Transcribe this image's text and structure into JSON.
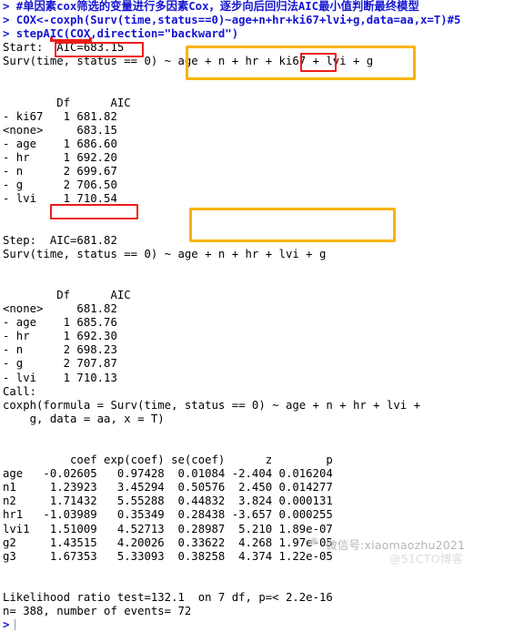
{
  "console": {
    "lines": [
      {
        "id": "l1",
        "type": "command",
        "text": "> #单因素cox筛选的变量进行多因素Cox，逐步向后回归法AIC最小值判断最终模型"
      },
      {
        "id": "l2",
        "type": "command",
        "text": "> COX<-coxph(Surv(time,status==0)~age+n+hr+ki67+lvi+g,data=aa,x=T)#5"
      },
      {
        "id": "l3",
        "type": "command",
        "text": "> stepAIC(COX,direction=\"backward\")"
      },
      {
        "id": "l4",
        "type": "output",
        "text": "Start:  AIC=683.15"
      },
      {
        "id": "l5",
        "type": "output",
        "text": "Surv(time, status == 0) ~ age + n + hr + ki67 + lvi + g"
      },
      {
        "id": "l6",
        "type": "blank",
        "text": ""
      },
      {
        "id": "l7",
        "type": "blank",
        "text": ""
      },
      {
        "id": "l8",
        "type": "output",
        "text": "        Df      AIC"
      },
      {
        "id": "l9",
        "type": "output",
        "text": "- ki67   1 681.82"
      },
      {
        "id": "l10",
        "type": "output",
        "text": "<none>     683.15"
      },
      {
        "id": "l11",
        "type": "output",
        "text": "- age    1 686.60"
      },
      {
        "id": "l12",
        "type": "output",
        "text": "- hr     1 692.20"
      },
      {
        "id": "l13",
        "type": "output",
        "text": "- n      2 699.67"
      },
      {
        "id": "l14",
        "type": "output",
        "text": "- g      2 706.50"
      },
      {
        "id": "l15",
        "type": "output",
        "text": "- lvi    1 710.54"
      },
      {
        "id": "l16",
        "type": "blank",
        "text": ""
      },
      {
        "id": "l17",
        "type": "blank",
        "text": ""
      },
      {
        "id": "l18",
        "type": "output",
        "text": "Step:  AIC=681.82"
      },
      {
        "id": "l19",
        "type": "output",
        "text": "Surv(time, status == 0) ~ age + n + hr + lvi + g"
      },
      {
        "id": "l20",
        "type": "blank",
        "text": ""
      },
      {
        "id": "l21",
        "type": "blank",
        "text": ""
      },
      {
        "id": "l22",
        "type": "output",
        "text": "        Df      AIC"
      },
      {
        "id": "l23",
        "type": "output",
        "text": "<none>     681.82"
      },
      {
        "id": "l24",
        "type": "output",
        "text": "- age    1 685.76"
      },
      {
        "id": "l25",
        "type": "output",
        "text": "- hr     1 692.30"
      },
      {
        "id": "l26",
        "type": "output",
        "text": "- n      2 698.23"
      },
      {
        "id": "l27",
        "type": "output",
        "text": "- g      2 707.87"
      },
      {
        "id": "l28",
        "type": "output",
        "text": "- lvi    1 710.13"
      },
      {
        "id": "l29",
        "type": "output",
        "text": "Call:"
      },
      {
        "id": "l30",
        "type": "output",
        "text": "coxph(formula = Surv(time, status == 0) ~ age + n + hr + lvi +"
      },
      {
        "id": "l31",
        "type": "output",
        "text": "    g, data = aa, x = T)"
      },
      {
        "id": "l32",
        "type": "blank",
        "text": ""
      },
      {
        "id": "l33",
        "type": "blank",
        "text": ""
      },
      {
        "id": "l34",
        "type": "output",
        "text": "          coef exp(coef) se(coef)      z        p"
      },
      {
        "id": "l35",
        "type": "output",
        "text": "age   -0.02605   0.97428  0.01084 -2.404 0.016204"
      },
      {
        "id": "l36",
        "type": "output",
        "text": "n1     1.23923   3.45294  0.50576  2.450 0.014277"
      },
      {
        "id": "l37",
        "type": "output",
        "text": "n2     1.71432   5.55288  0.44832  3.824 0.000131"
      },
      {
        "id": "l38",
        "type": "output",
        "text": "hr1   -1.03989   0.35349  0.28438 -3.657 0.000255"
      },
      {
        "id": "l39",
        "type": "output",
        "text": "lvi1   1.51009   4.52713  0.28987  5.210 1.89e-07"
      },
      {
        "id": "l40",
        "type": "output",
        "text": "g2     1.43515   4.20026  0.33622  4.268 1.97e-05"
      },
      {
        "id": "l41",
        "type": "output",
        "text": "g3     1.67353   5.33093  0.38258  4.374 1.22e-05"
      },
      {
        "id": "l42",
        "type": "blank",
        "text": ""
      },
      {
        "id": "l43",
        "type": "blank",
        "text": ""
      },
      {
        "id": "l44",
        "type": "output",
        "text": "Likelihood ratio test=132.1  on 7 df, p=< 2.2e-16"
      },
      {
        "id": "l45",
        "type": "output",
        "text": "n= 388, number of events= 72"
      },
      {
        "id": "l46",
        "type": "prompt",
        "text": ">"
      }
    ]
  },
  "annotations": {
    "start_aic_box": {
      "label": "AIC=683.15",
      "color": "#f01b1b"
    },
    "step_aic_box": {
      "label": "AIC=681.82",
      "color": "#f01b1b"
    },
    "ki67_box": {
      "label": "ki67",
      "color": "#f01b1b"
    },
    "start_formula_box": {
      "label": "age + n + hr + ki67 + lvi + g",
      "color": "#f9b400"
    },
    "step_formula_box": {
      "label": "age + n + hr + lvi + g",
      "color": "#f9b400"
    },
    "stepaic_underline": {
      "label": "stepAIC(COX",
      "color": "#f01b1b"
    }
  },
  "watermark": {
    "logo": "✺",
    "wechat": "微信号:xiaomaozhu2021",
    "site": "@51CTO博客"
  },
  "colors": {
    "command_text": "#1414d2",
    "output_text": "#000000",
    "highlight_red": "#f01b1b",
    "highlight_yellow": "#f9b400",
    "background": "#ffffff"
  }
}
